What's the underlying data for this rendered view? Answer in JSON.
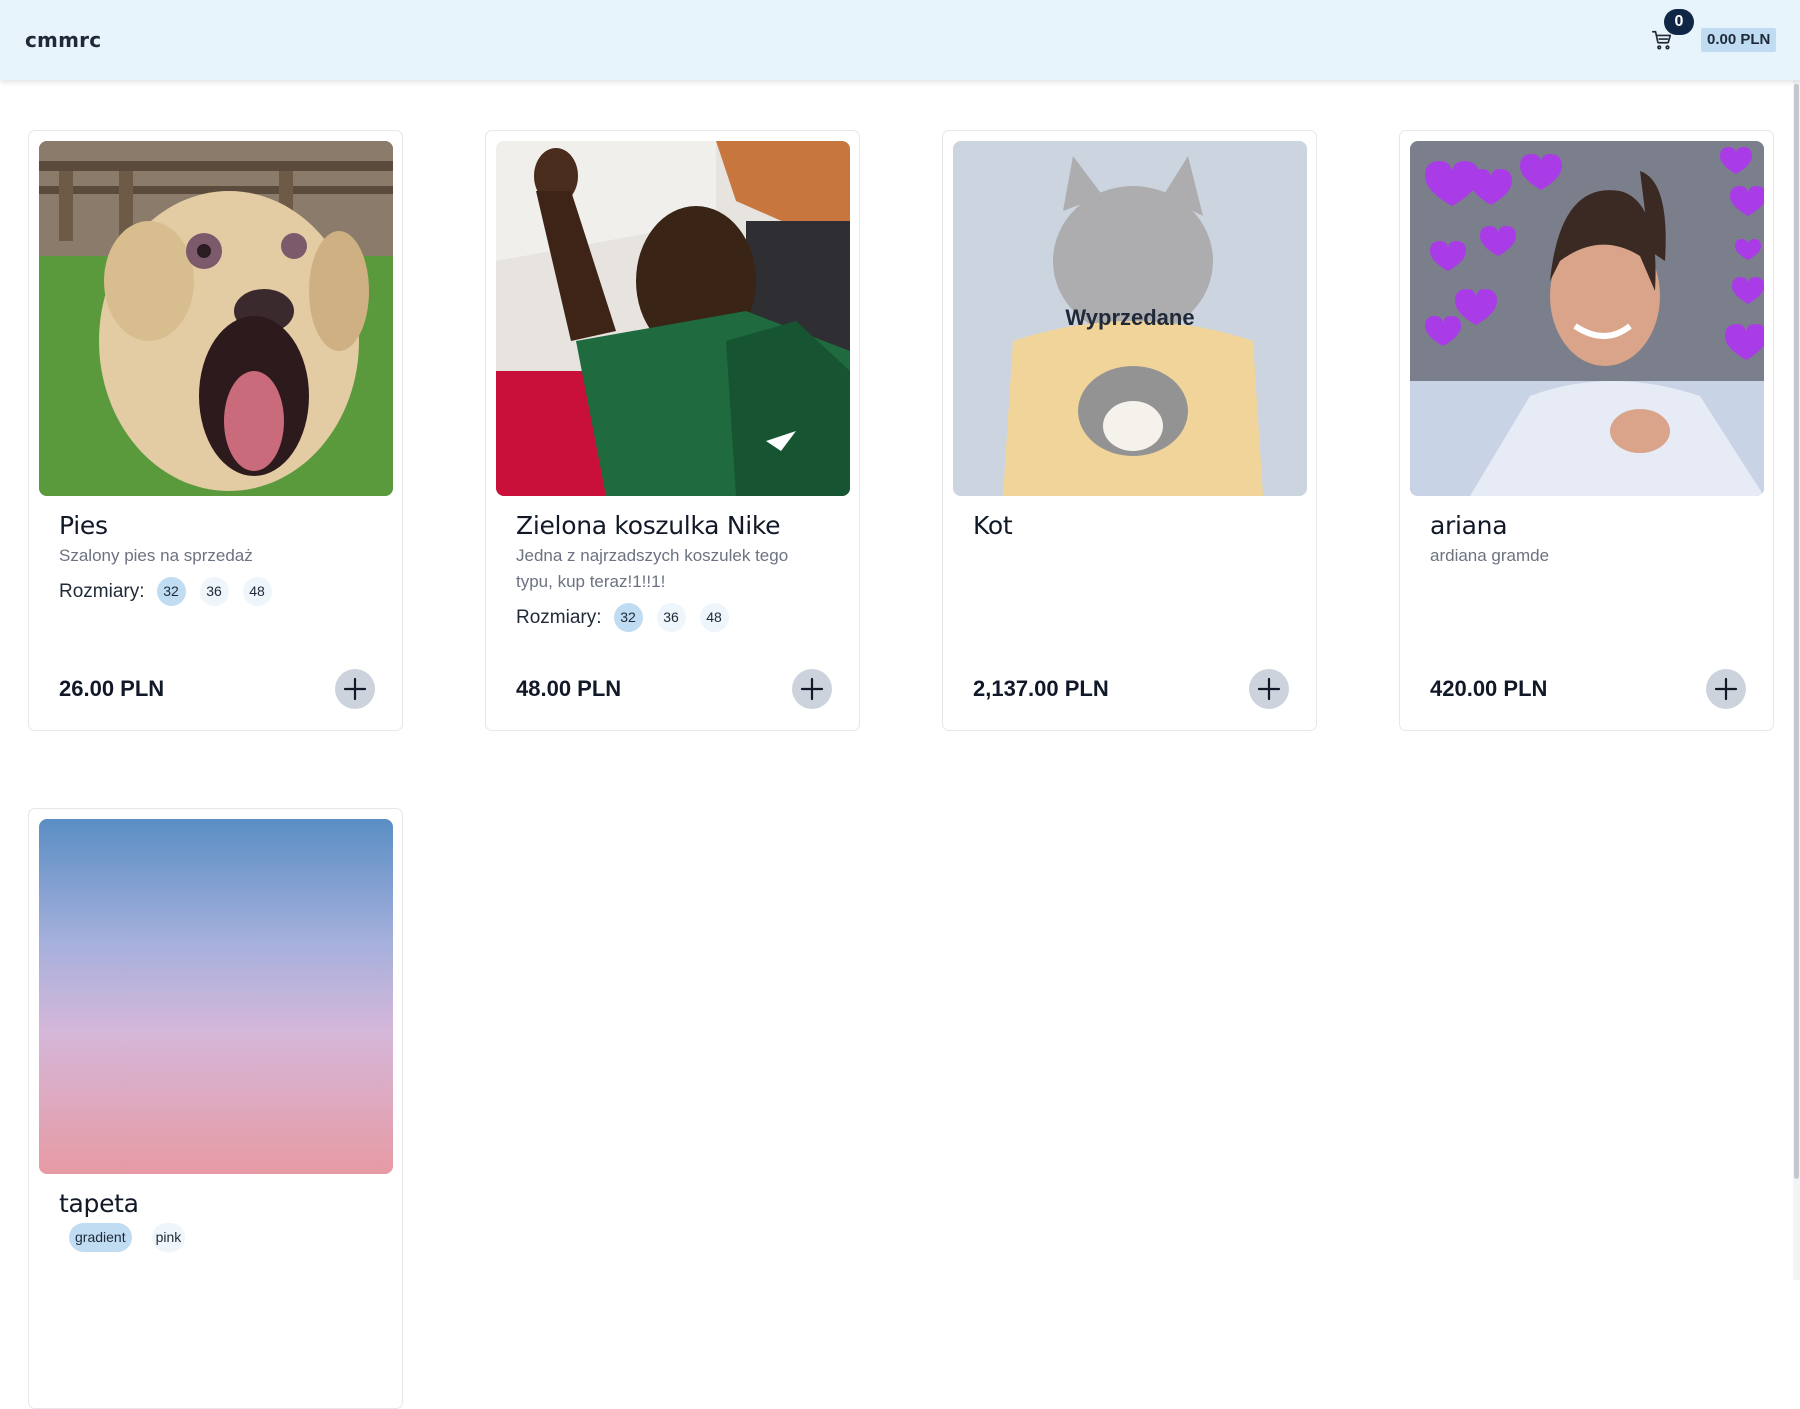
{
  "header": {
    "brand": "cmmrc",
    "cart_count": "0",
    "cart_total": "0.00 PLN",
    "cart_icon": "shopping-cart-icon"
  },
  "labels": {
    "sizes": "Rozmiary:",
    "sold_out": "Wyprzedane",
    "add_icon": "plus-icon"
  },
  "products": [
    {
      "name": "Pies",
      "description": "Szalony pies na sprzedaż",
      "sizes": [
        "32",
        "36",
        "48"
      ],
      "selected_size": "32",
      "price": "26.00 PLN",
      "image": "dog-photo",
      "sold_out": false
    },
    {
      "name": "Zielona koszulka Nike",
      "description": "Jedna z najrzadszych koszulek tego typu, kup teraz!1!!1!",
      "sizes": [
        "32",
        "36",
        "48"
      ],
      "selected_size": "32",
      "price": "48.00 PLN",
      "image": "man-green-shirt-photo",
      "sold_out": false
    },
    {
      "name": "Kot",
      "description": "",
      "price": "2,137.00 PLN",
      "image": "cat-photo",
      "sold_out": true
    },
    {
      "name": "ariana",
      "description": "ardiana gramde",
      "price": "420.00 PLN",
      "image": "woman-hearts-photo",
      "sold_out": false
    },
    {
      "name": "tapeta",
      "tags": [
        "gradient",
        "pink"
      ],
      "selected_tag": "gradient",
      "image": "gradient-wallpaper",
      "sold_out": false
    }
  ],
  "colors": {
    "header_bg": "#e8f4fc",
    "chip_active": "#bfdcf3",
    "chip": "#eef5fb",
    "add_button": "#cdd3dd",
    "badge": "#0f2744"
  }
}
